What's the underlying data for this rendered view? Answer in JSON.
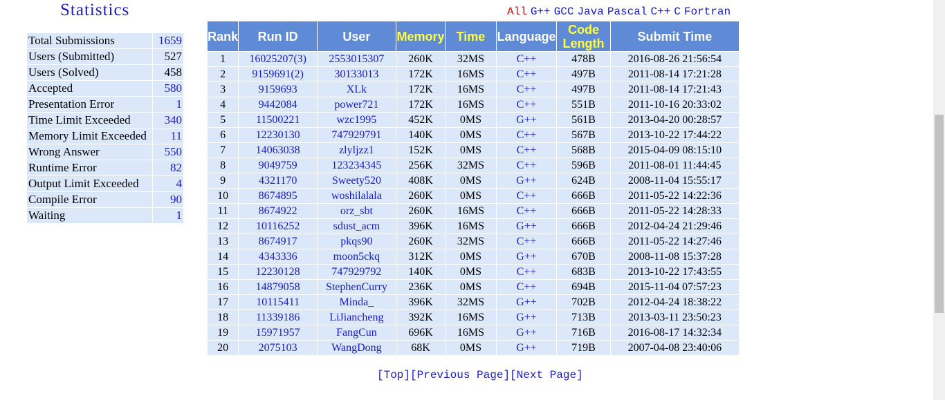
{
  "statistics": {
    "title": "Statistics",
    "rows": [
      {
        "label": "Total Submissions",
        "value": "1659",
        "link": true
      },
      {
        "label": "Users (Submitted)",
        "value": "527",
        "link": false
      },
      {
        "label": "Users (Solved)",
        "value": "458",
        "link": false
      },
      {
        "label": "Accepted",
        "value": "580",
        "link": true
      },
      {
        "label": "Presentation Error",
        "value": "1",
        "link": true
      },
      {
        "label": "Time Limit Exceeded",
        "value": "340",
        "link": true
      },
      {
        "label": "Memory Limit Exceeded",
        "value": "11",
        "link": true
      },
      {
        "label": "Wrong Answer",
        "value": "550",
        "link": true
      },
      {
        "label": "Runtime Error",
        "value": "82",
        "link": true
      },
      {
        "label": "Output Limit Exceeded",
        "value": "4",
        "link": true
      },
      {
        "label": "Compile Error",
        "value": "90",
        "link": true
      },
      {
        "label": "Waiting",
        "value": "1",
        "link": true
      }
    ]
  },
  "language_filter": {
    "selected": "All",
    "options": [
      "G++",
      "GCC",
      "Java",
      "Pascal",
      "C++",
      "C",
      "Fortran"
    ]
  },
  "ranking": {
    "headers": [
      "Rank",
      "Run ID",
      "User",
      "Memory",
      "Time",
      "Language",
      "Code Length",
      "Submit Time"
    ],
    "rows": [
      [
        "1",
        "16025207(3)",
        "2553015307",
        "260K",
        "32MS",
        "C++",
        "478B",
        "2016-08-26 21:56:54"
      ],
      [
        "2",
        "9159691(2)",
        "30133013",
        "172K",
        "16MS",
        "C++",
        "497B",
        "2011-08-14 17:21:28"
      ],
      [
        "3",
        "9159693",
        "XLk",
        "172K",
        "16MS",
        "C++",
        "497B",
        "2011-08-14 17:21:43"
      ],
      [
        "4",
        "9442084",
        "power721",
        "172K",
        "16MS",
        "C++",
        "551B",
        "2011-10-16 20:33:02"
      ],
      [
        "5",
        "11500221",
        "wzc1995",
        "452K",
        "0MS",
        "G++",
        "561B",
        "2013-04-20 00:28:57"
      ],
      [
        "6",
        "12230130",
        "747929791",
        "140K",
        "0MS",
        "C++",
        "567B",
        "2013-10-22 17:44:22"
      ],
      [
        "7",
        "14063038",
        "zlyljzz1",
        "152K",
        "0MS",
        "C++",
        "568B",
        "2015-04-09 08:15:10"
      ],
      [
        "8",
        "9049759",
        "123234345",
        "256K",
        "32MS",
        "C++",
        "596B",
        "2011-08-01 11:44:45"
      ],
      [
        "9",
        "4321170",
        "Sweety520",
        "408K",
        "0MS",
        "G++",
        "624B",
        "2008-11-04 15:55:17"
      ],
      [
        "10",
        "8674895",
        "woshilalala",
        "260K",
        "0MS",
        "C++",
        "666B",
        "2011-05-22 14:22:36"
      ],
      [
        "11",
        "8674922",
        "orz_sbt",
        "260K",
        "16MS",
        "C++",
        "666B",
        "2011-05-22 14:28:33"
      ],
      [
        "12",
        "10116252",
        "sdust_acm",
        "396K",
        "16MS",
        "G++",
        "666B",
        "2012-04-24 21:29:46"
      ],
      [
        "13",
        "8674917",
        "pkqs90",
        "260K",
        "32MS",
        "C++",
        "666B",
        "2011-05-22 14:27:46"
      ],
      [
        "14",
        "4343336",
        "moon5ckq",
        "312K",
        "0MS",
        "G++",
        "670B",
        "2008-11-08 15:37:28"
      ],
      [
        "15",
        "12230128",
        "747929792",
        "140K",
        "0MS",
        "C++",
        "683B",
        "2013-10-22 17:43:55"
      ],
      [
        "16",
        "14879058",
        "StephenCurry",
        "236K",
        "0MS",
        "C++",
        "694B",
        "2015-11-04 07:57:23"
      ],
      [
        "17",
        "10115411",
        "Minda_",
        "396K",
        "32MS",
        "G++",
        "702B",
        "2012-04-24 18:38:22"
      ],
      [
        "18",
        "11339186",
        "LiJiancheng",
        "392K",
        "16MS",
        "G++",
        "713B",
        "2013-03-11 23:50:23"
      ],
      [
        "19",
        "15971957",
        "FangCun",
        "696K",
        "16MS",
        "G++",
        "716B",
        "2016-08-17 14:32:34"
      ],
      [
        "20",
        "2075103",
        "WangDong",
        "68K",
        "0MS",
        "G++",
        "719B",
        "2007-04-08 23:40:06"
      ]
    ]
  },
  "pager": {
    "top": "[Top]",
    "previous": "[Previous Page]",
    "next": "[Next Page]"
  }
}
